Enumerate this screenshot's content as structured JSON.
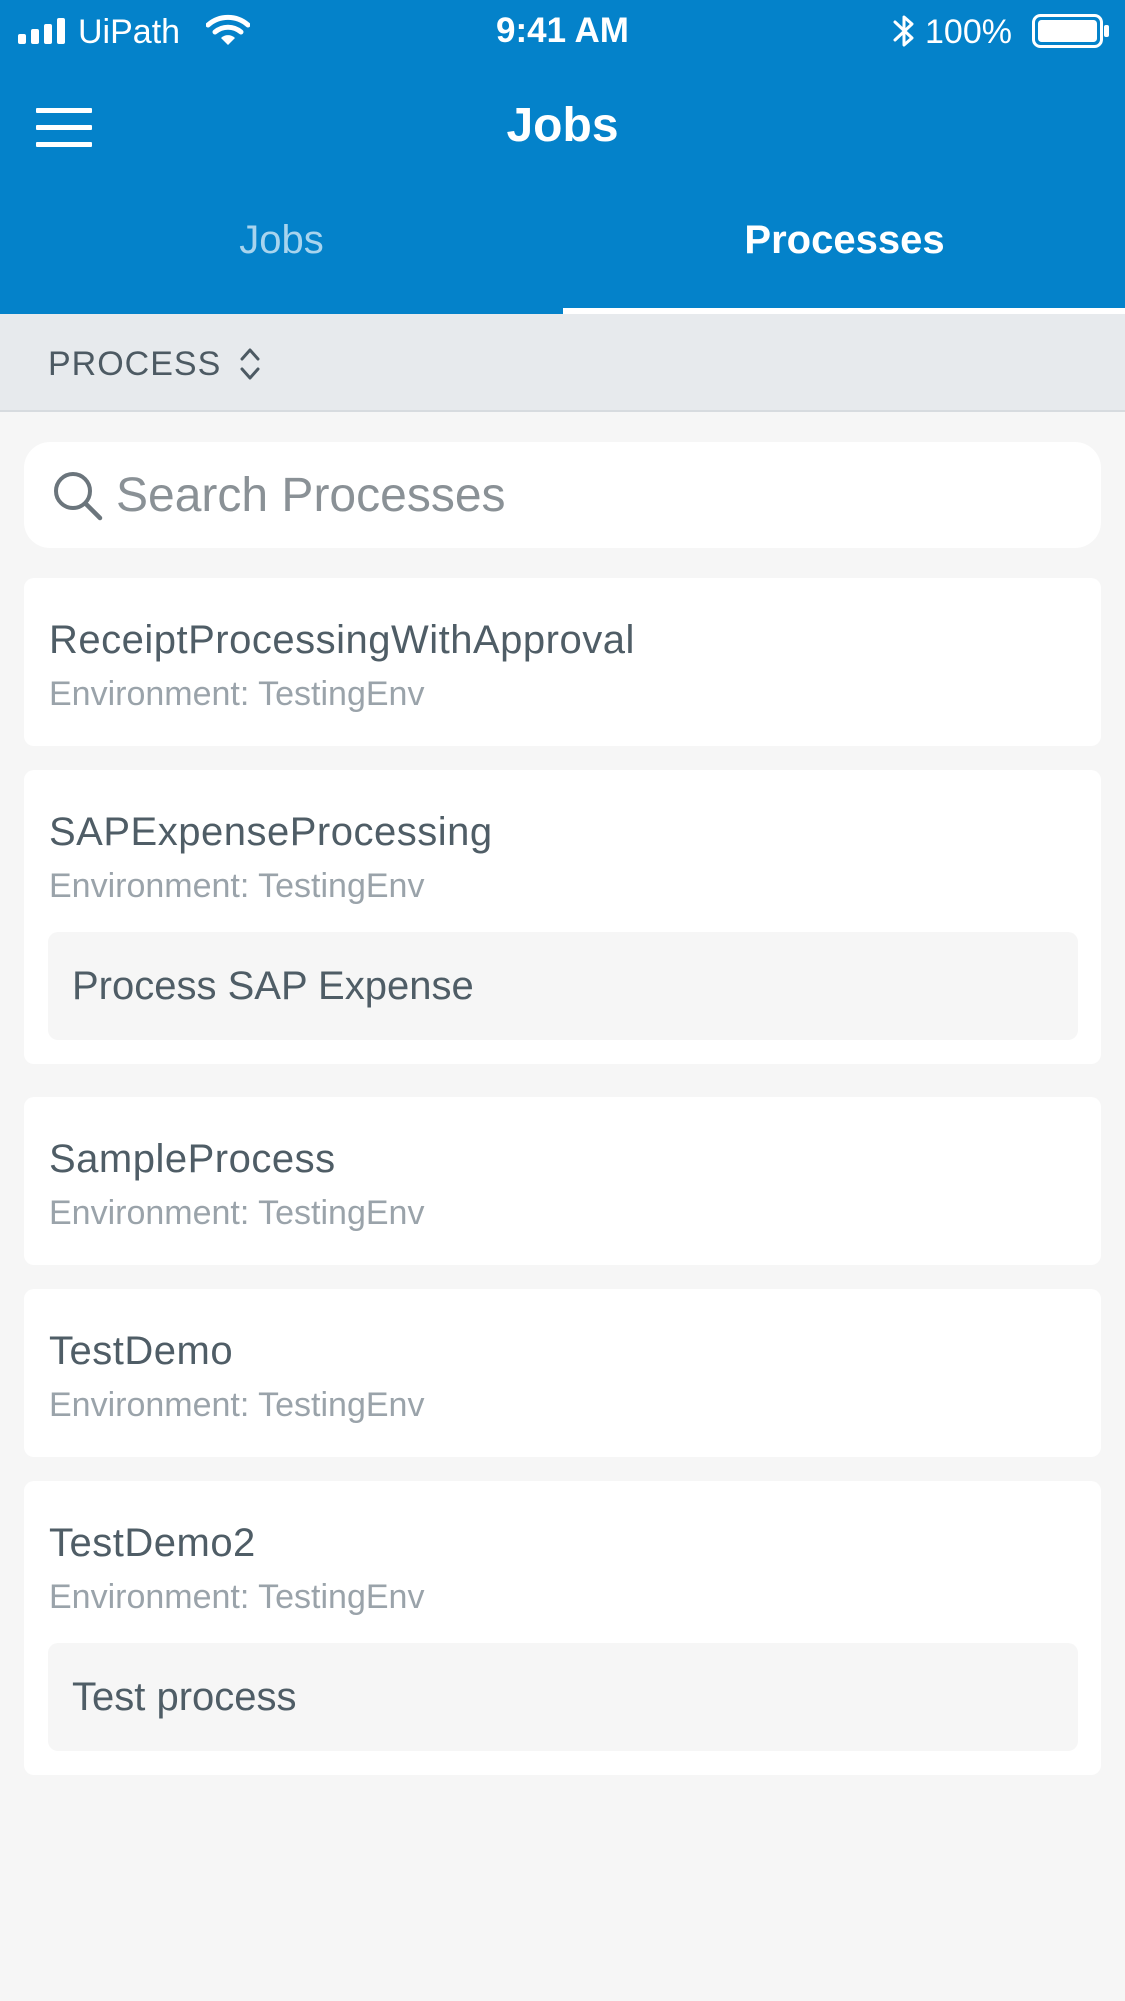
{
  "status_bar": {
    "carrier": "UiPath",
    "time": "9:41 AM",
    "battery": "100%"
  },
  "nav": {
    "title": "Jobs",
    "menu_icon": "hamburger-menu-icon"
  },
  "tabs": [
    {
      "label": "Jobs",
      "active": false
    },
    {
      "label": "Processes",
      "active": true
    }
  ],
  "sort": {
    "label": "PROCESS",
    "icon": "sort-updown-icon"
  },
  "search": {
    "placeholder": "Search Processes",
    "value": ""
  },
  "processes": [
    {
      "name": "ReceiptProcessingWithApproval",
      "environment": "Environment: TestingEnv"
    },
    {
      "name": "SAPExpenseProcessing",
      "environment": "Environment: TestingEnv",
      "description": "Process SAP Expense"
    },
    {
      "name": "SampleProcess",
      "environment": "Environment: TestingEnv"
    },
    {
      "name": "TestDemo",
      "environment": "Environment: TestingEnv"
    },
    {
      "name": "TestDemo2",
      "environment": "Environment: TestingEnv",
      "description": "Test process"
    }
  ],
  "colors": {
    "header_blue": "#0482ca",
    "inactive_tab": "#a8d4ee",
    "background": "#f6f6f6",
    "title_text": "#4f5d66",
    "secondary_text": "#9aa3aa"
  }
}
